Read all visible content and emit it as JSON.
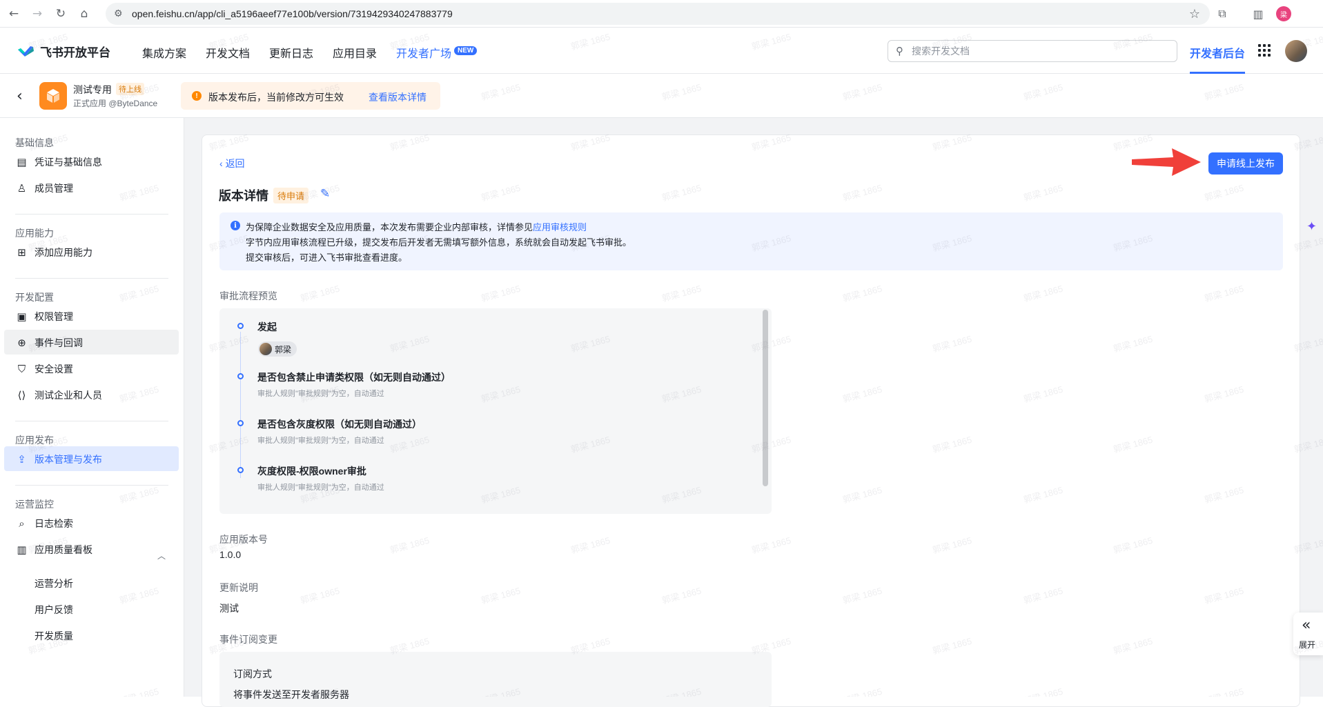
{
  "browser": {
    "url": "open.feishu.cn/app/cli_a5196aeef77e100b/version/7319429340247883779",
    "profile_initial": "梁",
    "icons": [
      "back-icon",
      "forward-icon",
      "reload-icon",
      "home-icon",
      "site-settings-icon",
      "bookmark-star-icon",
      "extensions-icon",
      "sidepanel-icon"
    ]
  },
  "topnav": {
    "logo_text": "飞书开放平台",
    "menu": [
      "集成方案",
      "开发文档",
      "更新日志",
      "应用目录"
    ],
    "developer_square": "开发者广场",
    "new_badge": "NEW",
    "search_placeholder": "搜索开发文档",
    "dev_console": "开发者后台"
  },
  "app_header": {
    "name": "测试专用",
    "status": "待上线",
    "subtitle": "正式应用 @ByteDance",
    "notice_text": "版本发布后，当前修改方可生效",
    "notice_link": "查看版本详情"
  },
  "sidebar": {
    "groups": [
      {
        "title": "基础信息",
        "items": [
          "凭证与基础信息",
          "成员管理"
        ]
      },
      {
        "title": "应用能力",
        "items": [
          "添加应用能力"
        ]
      },
      {
        "title": "开发配置",
        "items": [
          "权限管理",
          "事件与回调",
          "安全设置",
          "测试企业和人员"
        ]
      },
      {
        "title": "应用发布",
        "items": [
          "版本管理与发布"
        ]
      },
      {
        "title": "运营监控",
        "items": [
          "日志检索",
          "应用质量看板"
        ]
      }
    ],
    "quality_sub": [
      "运营分析",
      "用户反馈",
      "开发质量"
    ],
    "active_item": "版本管理与发布",
    "hover_item": "事件与回调"
  },
  "main": {
    "back": "返回",
    "title": "版本详情",
    "status_badge": "待申请",
    "apply_button": "申请线上发布",
    "info": {
      "line1_prefix": "为保障企业数据安全及应用质量，本次发布需要企业内部审核，详情参见",
      "line1_link": "应用审核规则",
      "line2": "字节内应用审核流程已升级，提交发布后开发者无需填写额外信息，系统就会自动发起飞书审批。",
      "line3": "提交审核后，可进入飞书审批查看进度。"
    },
    "approval_label": "审批流程预览",
    "approval_steps": [
      {
        "title": "发起",
        "user": "郭梁"
      },
      {
        "title": "是否包含禁止申请类权限（如无则自动通过）",
        "desc": "审批人规则\"审批规则\"为空，自动通过"
      },
      {
        "title": "是否包含灰度权限（如无则自动通过）",
        "desc": "审批人规则\"审批规则\"为空，自动通过"
      },
      {
        "title": "灰度权限-权限owner审批",
        "desc": "审批人规则\"审批规则\"为空，自动通过"
      }
    ],
    "version_label": "应用版本号",
    "version_value": "1.0.0",
    "notes_label": "更新说明",
    "notes_value": "测试",
    "event_label": "事件订阅变更",
    "subscription_key": "订阅方式",
    "subscription_value": "将事件发送至开发者服务器"
  },
  "floating": {
    "expand": "展开"
  },
  "watermark": "郭梁 1865",
  "colors": {
    "accent": "#3370ff",
    "warning": "#ff8800",
    "arrow": "#f0403a"
  }
}
